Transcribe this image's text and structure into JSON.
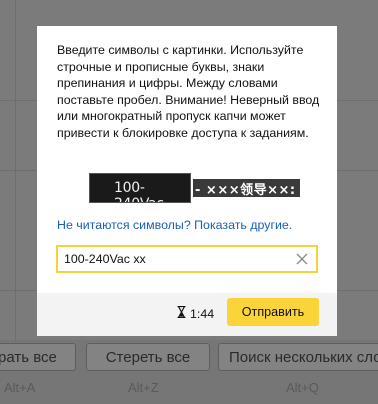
{
  "background": {
    "buttons": [
      "рать все",
      "Стереть все",
      "Поиск нескольких сло"
    ],
    "hints": [
      "Alt+A",
      "Alt+Z",
      "Alt+Q"
    ]
  },
  "captcha": {
    "instructions": "Введите символы с картинки. Используйте строчные и прописные буквы, знаки препинания и цифры. Между словами поставьте пробел. Внимание! Неверный ввод или многократный пропуск капчи может привести к блокировке доступа к заданиям.",
    "image1_text": "100-240Vac",
    "image2_text": "- ×××领导××:",
    "refresh_link": "Не читаются символы? Показать другие.",
    "input_value": "100-240Vac xx",
    "timer": "1:44",
    "submit_label": "Отправить",
    "accent_color": "#fbd43a",
    "link_color": "#1a5fb4"
  }
}
